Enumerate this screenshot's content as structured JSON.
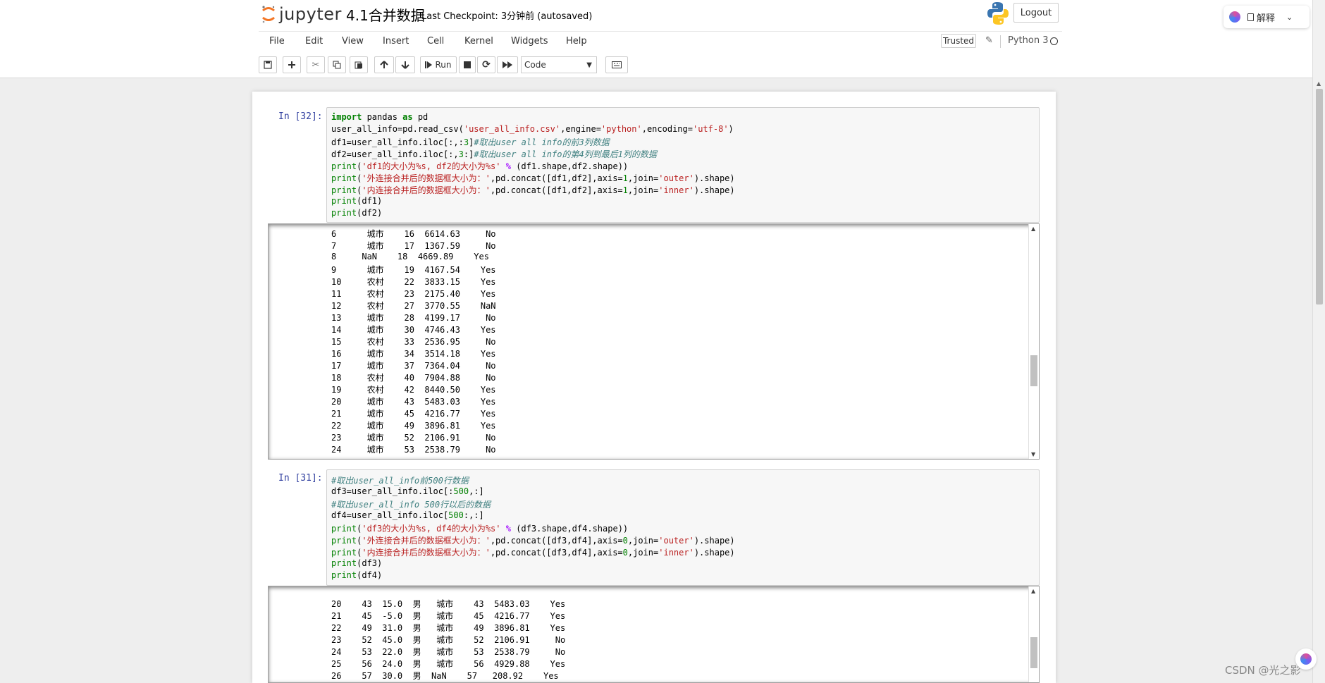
{
  "header": {
    "logo_text": "jupyter",
    "notebook_title": "4.1合并数据",
    "checkpoint": "Last Checkpoint: 3分钟前   (autosaved)",
    "logout_label": "Logout"
  },
  "explain_widget": {
    "label": "解释"
  },
  "menu": [
    "File",
    "Edit",
    "View",
    "Insert",
    "Cell",
    "Kernel",
    "Widgets",
    "Help"
  ],
  "status": {
    "trusted": "Trusted",
    "kernel": "Python 3"
  },
  "toolbar": {
    "run_label": "Run",
    "cell_type": "Code"
  },
  "cells": [
    {
      "prompt": "In  [32]:",
      "output_lines": [
        "6      城市    16  6614.63     No",
        "7      城市    17  1367.59     No",
        "8     NaN    18  4669.89    Yes",
        "9      城市    19  4167.54    Yes",
        "10     农村    22  3833.15    Yes",
        "11     农村    23  2175.40    Yes",
        "12     农村    27  3770.55    NaN",
        "13     城市    28  4199.17     No",
        "14     城市    30  4746.43    Yes",
        "15     农村    33  2536.95     No",
        "16     城市    34  3514.18    Yes",
        "17     城市    37  7364.04     No",
        "18     农村    40  7904.88     No",
        "19     农村    42  8440.50    Yes",
        "20     城市    43  5483.03    Yes",
        "21     城市    45  4216.77    Yes",
        "22     城市    49  3896.81    Yes",
        "23     城市    52  2106.91     No",
        "24     城市    53  2538.79     No"
      ]
    },
    {
      "prompt": "In  [31]:",
      "output_lines": [
        "20    43  15.0  男   城市    43  5483.03    Yes",
        "21    45  -5.0  男   城市    45  4216.77    Yes",
        "22    49  31.0  男   城市    49  3896.81    Yes",
        "23    52  45.0  男   城市    52  2106.91     No",
        "24    53  22.0  男   城市    53  2538.79     No",
        "25    56  24.0  男   城市    56  4929.88    Yes",
        "26    57  30.0  男  NaN    57   208.92    Yes"
      ]
    }
  ],
  "watermark": "CSDN @光之影"
}
